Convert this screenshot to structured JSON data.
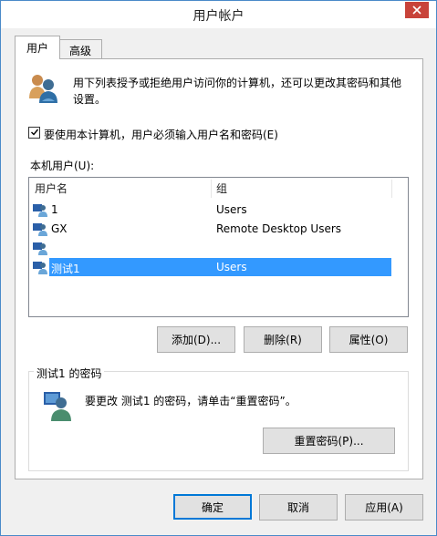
{
  "window": {
    "title": "用户帐户"
  },
  "tabs": [
    {
      "label": "用户"
    },
    {
      "label": "高级"
    }
  ],
  "intro": {
    "text_line1": "用下列表授予或拒绝用户访问你的计算机，还可以更改其密码和其他",
    "text_line2": "设置。"
  },
  "require_login": {
    "label": "要使用本计算机，用户必须输入用户名和密码(E)",
    "checked": true
  },
  "local_users": {
    "label": "本机用户(U):",
    "columns": [
      {
        "label": "用户名"
      },
      {
        "label": "组"
      }
    ],
    "rows": [
      {
        "name": "1",
        "group": "Users"
      },
      {
        "name": "GX",
        "group": "Remote Desktop Users"
      },
      {
        "name": "",
        "group": ""
      },
      {
        "name": "测试1",
        "group": "Users"
      }
    ],
    "selected_index": 3
  },
  "actions": {
    "add": "添加(D)...",
    "remove": "删除(R)",
    "properties": "属性(O)"
  },
  "password_group": {
    "label": "测试1 的密码",
    "message": "要更改 测试1 的密码，请单击“重置密码”。",
    "reset_button": "重置密码(P)..."
  },
  "footer": {
    "ok": "确定",
    "cancel": "取消",
    "apply": "应用(A)"
  },
  "colors": {
    "selection": "#3399ff",
    "close": "#c8433a",
    "accent": "#0078d7"
  },
  "icons": [
    "users-icon",
    "user-icon",
    "close-icon",
    "checkmark-icon"
  ]
}
